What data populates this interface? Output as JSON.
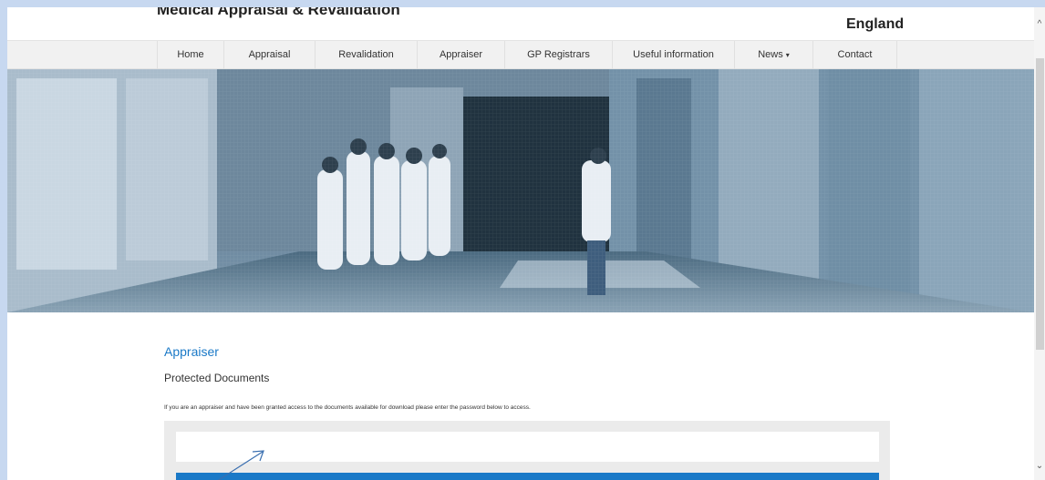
{
  "header": {
    "site_title": "Medical Appraisal & Revalidation",
    "region": "England"
  },
  "nav": {
    "items": [
      {
        "label": "Home"
      },
      {
        "label": "Appraisal"
      },
      {
        "label": "Revalidation"
      },
      {
        "label": "Appraiser"
      },
      {
        "label": "GP Registrars"
      },
      {
        "label": "Useful information"
      },
      {
        "label": "News",
        "has_dropdown": true
      },
      {
        "label": "Contact"
      }
    ]
  },
  "hero": {
    "tint_color": "#5f7e98"
  },
  "main": {
    "title": "Appraiser",
    "subtitle": "Protected Documents",
    "intro": "If you are an appraiser and have been granted access to the documents available for download please enter the password below to access.",
    "password_placeholder": "",
    "accent_color": "#1a79c7"
  },
  "scrollbar": {
    "up_icon": "chevron-up-icon",
    "down_icon": "chevron-down-icon"
  }
}
